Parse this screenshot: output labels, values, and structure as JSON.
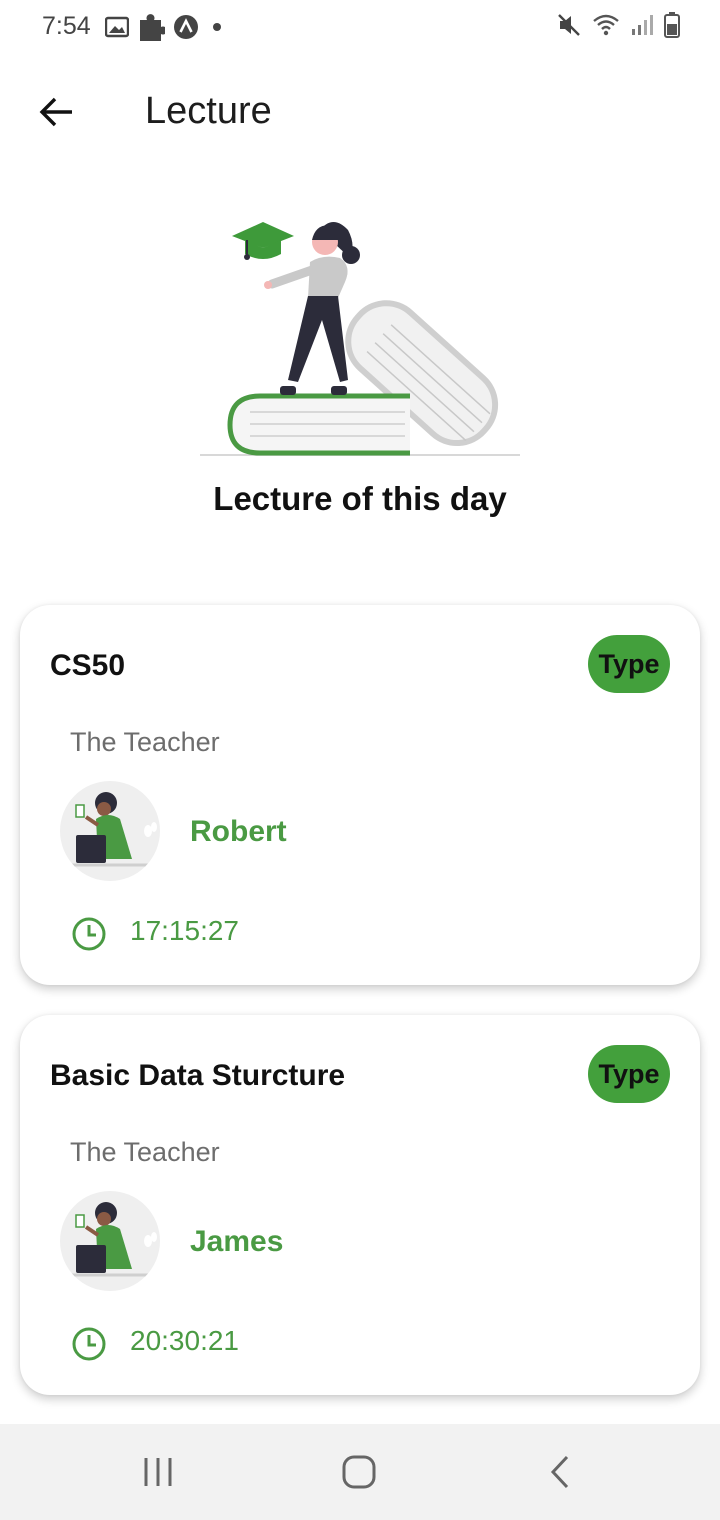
{
  "status_bar": {
    "time": "7:54",
    "left_icons": [
      "image-icon",
      "puzzle-icon",
      "a-icon",
      "dot-icon"
    ],
    "right_icons": [
      "mute-icon",
      "wifi-icon",
      "signal-icon",
      "battery-icon"
    ]
  },
  "app_bar": {
    "title": "Lecture",
    "back_icon": "arrow-left-icon"
  },
  "hero": {
    "caption": "Lecture of this day",
    "illustration": "graduate-on-books-illustration"
  },
  "lectures": [
    {
      "course": "CS50",
      "badge": "Type",
      "teacher_heading": "The Teacher",
      "teacher_name": "Robert",
      "time": "17:15:27"
    },
    {
      "course": "Basic Data Sturcture",
      "badge": "Type",
      "teacher_heading": "The Teacher",
      "teacher_name": "James",
      "time": "20:30:21"
    }
  ],
  "colors": {
    "accent": "#4a9a43",
    "badge": "#43a03c",
    "muted_text": "#6d6d6d"
  },
  "nav_bar": {
    "buttons": [
      "recent-apps-icon",
      "home-icon",
      "back-icon"
    ]
  }
}
